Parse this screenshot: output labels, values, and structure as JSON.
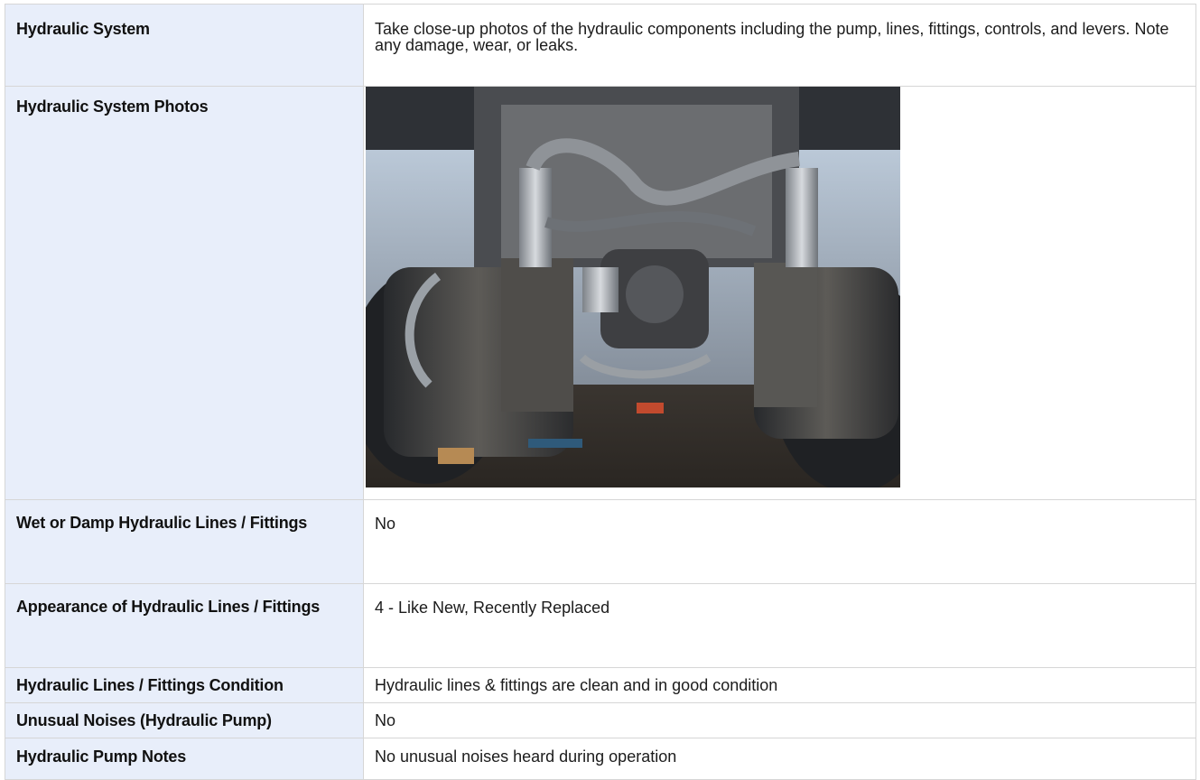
{
  "rows": [
    {
      "label": "Hydraulic System",
      "value": "Take close-up photos of the hydraulic components including the pump, lines, fittings, controls, and levers. Note any damage, wear, or leaks."
    },
    {
      "label": "Hydraulic System Photos"
    },
    {
      "label": "Wet or Damp Hydraulic Lines / Fittings",
      "value": "No"
    },
    {
      "label": "Appearance of Hydraulic Lines / Fittings",
      "value": "4 - Like New, Recently Replaced"
    },
    {
      "label": "Hydraulic Lines / Fittings Condition",
      "value": "Hydraulic lines & fittings are clean and in good condition"
    },
    {
      "label": "Unusual Noises (Hydraulic Pump)",
      "value": "No"
    },
    {
      "label": "Hydraulic Pump Notes",
      "value": "No unusual noises heard during operation"
    }
  ],
  "colors": {
    "label_background": "#e8eefa",
    "border": "#d6d6d6"
  }
}
